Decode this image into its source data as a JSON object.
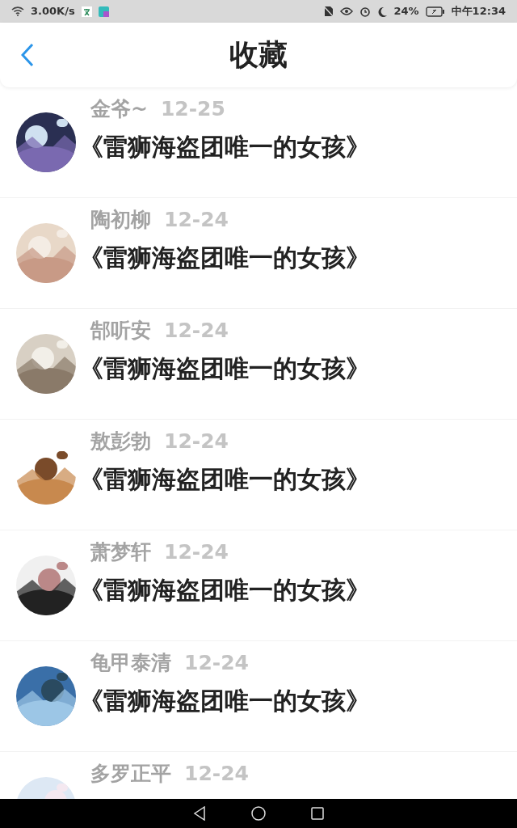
{
  "status_bar": {
    "speed": "3.00K/s",
    "battery": "24%",
    "time": "中午12:34"
  },
  "header": {
    "title": "收藏"
  },
  "items": [
    {
      "name": "金爷~",
      "date": "12-25",
      "title": "《雷狮海盗团唯一的女孩》"
    },
    {
      "name": "陶初柳",
      "date": "12-24",
      "title": "《雷狮海盗团唯一的女孩》"
    },
    {
      "name": "郜听安",
      "date": "12-24",
      "title": "《雷狮海盗团唯一的女孩》"
    },
    {
      "name": "敖彭勃",
      "date": "12-24",
      "title": "《雷狮海盗团唯一的女孩》"
    },
    {
      "name": "萧梦轩",
      "date": "12-24",
      "title": "《雷狮海盗团唯一的女孩》"
    },
    {
      "name": "龟甲泰清",
      "date": "12-24",
      "title": "《雷狮海盗团唯一的女孩》"
    },
    {
      "name": "多罗正平",
      "date": "12-24"
    }
  ]
}
